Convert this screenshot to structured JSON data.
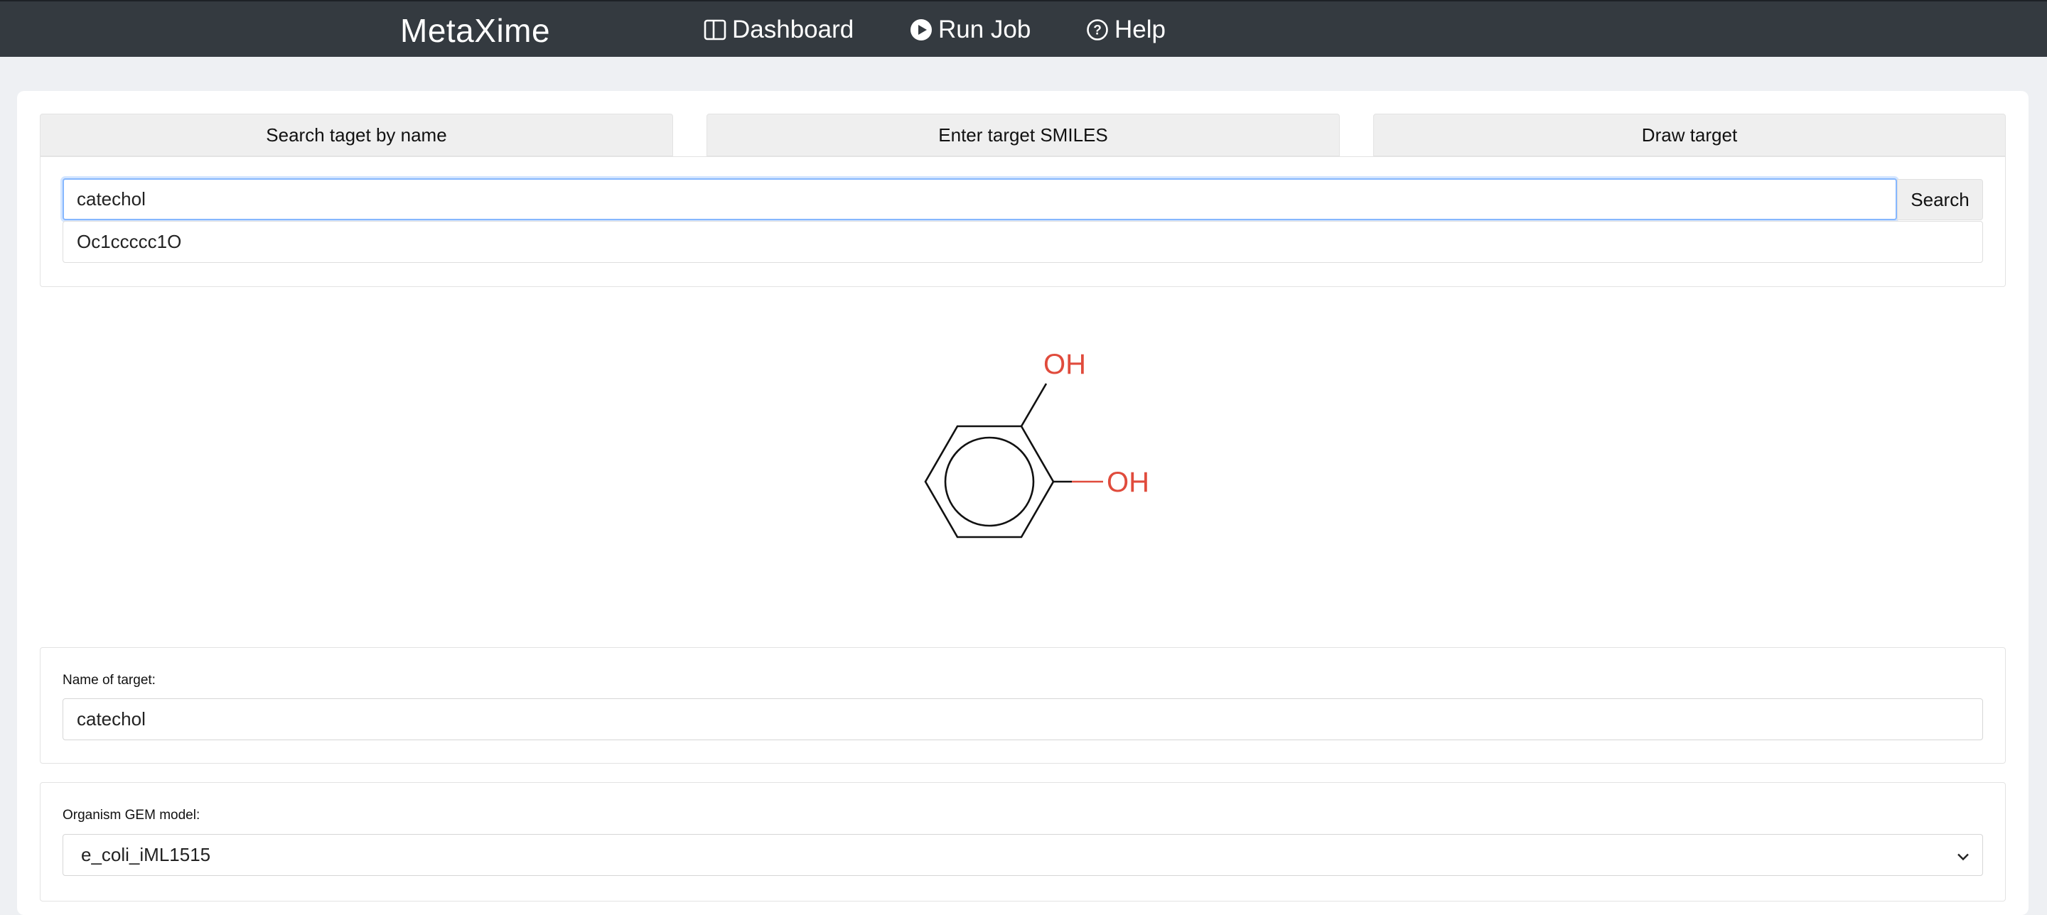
{
  "navbar": {
    "brand": "MetaXime",
    "items": [
      {
        "label": "Dashboard",
        "icon": "layout-icon"
      },
      {
        "label": "Run Job",
        "icon": "play-circle-icon"
      },
      {
        "label": "Help",
        "icon": "question-circle-icon"
      }
    ]
  },
  "tabs": [
    {
      "label": "Search taget by name"
    },
    {
      "label": "Enter target SMILES"
    },
    {
      "label": "Draw target"
    }
  ],
  "search": {
    "value": "catechol",
    "button_label": "Search",
    "result": "Oc1ccccc1O"
  },
  "molecule": {
    "atom_labels": [
      "OH",
      "OH"
    ],
    "heteroatom_color": "#e04b3c"
  },
  "form": {
    "name_label": "Name of target:",
    "name_value": "catechol",
    "organism_label": "Organism GEM model:",
    "organism_value": "e_coli_iML1515"
  },
  "colors": {
    "navbar_bg": "#343a40",
    "page_bg": "#eef0f3",
    "focus_border": "#86b7fe"
  }
}
